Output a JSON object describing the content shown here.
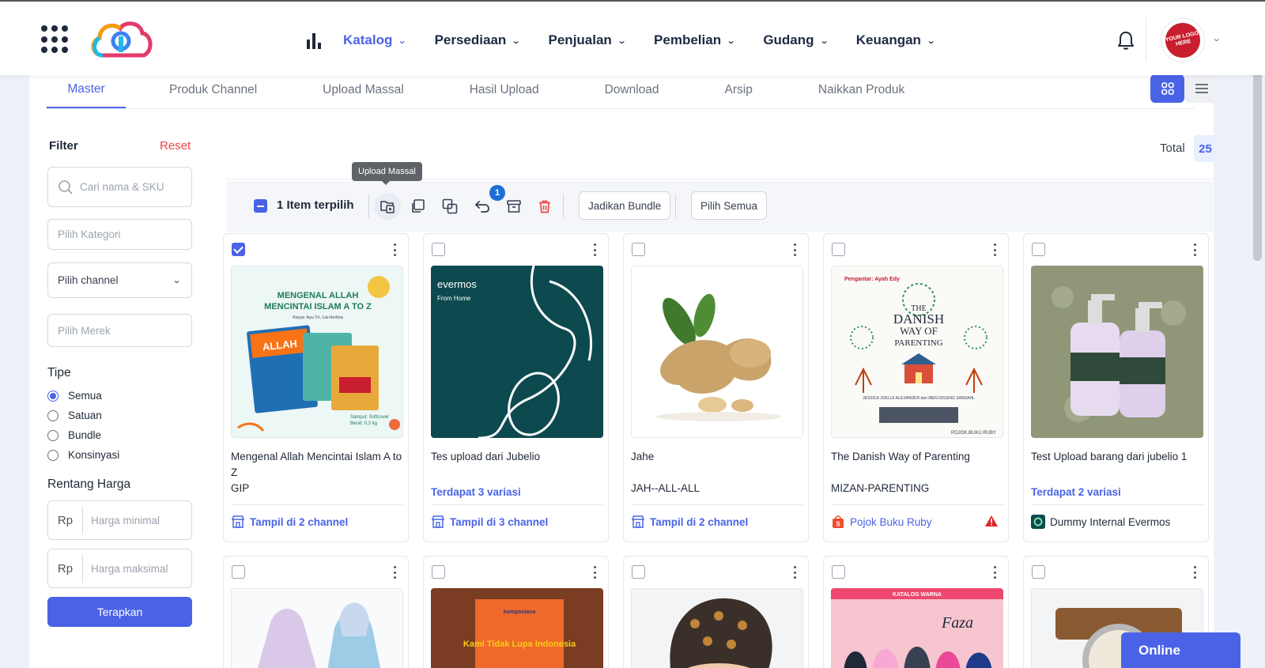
{
  "nav": {
    "items": [
      {
        "label": "Katalog",
        "active": true
      },
      {
        "label": "Persediaan"
      },
      {
        "label": "Penjualan"
      },
      {
        "label": "Pembelian"
      },
      {
        "label": "Gudang"
      },
      {
        "label": "Keuangan"
      }
    ],
    "avatar_text": "YOUR LOGO HERE"
  },
  "tabs": [
    "Master",
    "Produk Channel",
    "Upload Massal",
    "Hasil Upload",
    "Download",
    "Arsip",
    "Naikkan Produk"
  ],
  "filter": {
    "title": "Filter",
    "reset": "Reset",
    "search_placeholder": "Cari nama & SKU",
    "category_placeholder": "Pilih Kategori",
    "channel_placeholder": "Pilih channel",
    "brand_placeholder": "Pilih Merek",
    "type_title": "Tipe",
    "types": [
      "Semua",
      "Satuan",
      "Bundle",
      "Konsinyasi"
    ],
    "selected_type": "Semua",
    "price_title": "Rentang Harga",
    "currency": "Rp",
    "min_placeholder": "Harga minimal",
    "max_placeholder": "Harga maksimal",
    "apply": "Terapkan"
  },
  "total": {
    "label": "Total",
    "value": "25"
  },
  "bulk": {
    "selected_text": "1 Item terpilih",
    "tooltip": "Upload Massal",
    "badge": "1",
    "bundle_btn": "Jadikan Bundle",
    "select_all_btn": "Pilih Semua"
  },
  "products": [
    {
      "name": "Mengenal Allah Mencintai Islam A to Z",
      "sku": "GIP",
      "footer": "Tampil di 2 channel",
      "checked": true
    },
    {
      "name": "Tes upload dari Jubelio",
      "variasi": "Terdapat 3 variasi",
      "footer": "Tampil di 3 channel"
    },
    {
      "name": "Jahe",
      "sku": "JAH--ALL-ALL",
      "footer": "Tampil di 2 channel"
    },
    {
      "name": "The Danish Way of Parenting",
      "sku": "MIZAN-PARENTING",
      "footer": "Pojok Buku Ruby"
    },
    {
      "name": "Test Upload barang dari jubelio 1",
      "variasi": "Terdapat 2 variasi",
      "footer": "Dummy Internal Evermos"
    }
  ],
  "image_text": {
    "book1_title": "MENGENAL ALLAH MENCINTAI ISLAM A TO Z",
    "book1_author": "Karya: Ayu Tri, Lia Herlina",
    "book1_cover": "Sampul: Softcover Berat: 0,3 kg",
    "evermos": "evermos",
    "from_home": "From Home",
    "danish_top": "Pengantar: Ayah Edy",
    "danish_the": "THE",
    "danish_danish": "DANISH",
    "danish_way": "WAY OF",
    "danish_parenting": "PARENTING",
    "danish_authors": "JESSICA JOELLE ALEXANDER dan IBEN DISSING SANDAHL",
    "danish_shop": "POJOK.BUKU.RUBY",
    "kompasiana": "kompasiana",
    "kami_title": "Kami Tidak Lupa Indonesia",
    "katalog_warna": "KATALOG WARNA",
    "faza": "Faza"
  },
  "online_btn": "Online",
  "colors": {
    "accent": "#4a63e6",
    "danger": "#ef4444",
    "badge": "#1d6fd6"
  }
}
